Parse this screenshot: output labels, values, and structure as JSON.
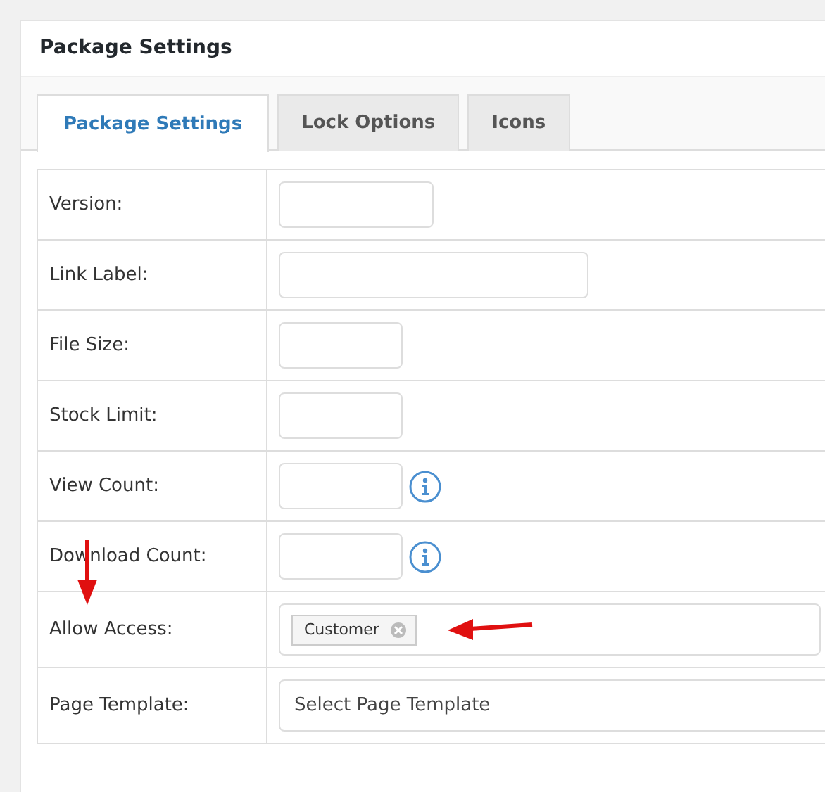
{
  "panel": {
    "title": "Package Settings"
  },
  "tabs": [
    {
      "label": "Package Settings",
      "selected": true
    },
    {
      "label": "Lock Options",
      "selected": false
    },
    {
      "label": "Icons",
      "selected": false
    }
  ],
  "fields": [
    {
      "kind": "input",
      "label": "Version:"
    },
    {
      "kind": "input",
      "label": "Link Label:"
    },
    {
      "kind": "input",
      "label": "File Size:"
    },
    {
      "kind": "input",
      "label": "Stock Limit:"
    },
    {
      "kind": "info",
      "label": "View Count:"
    },
    {
      "kind": "info",
      "label": "Download Count:"
    },
    {
      "kind": "tags",
      "label": "Allow Access:",
      "tags": [
        "Customer"
      ]
    },
    {
      "kind": "select",
      "label": "Page Template:",
      "value": "Select Page Template"
    }
  ]
}
